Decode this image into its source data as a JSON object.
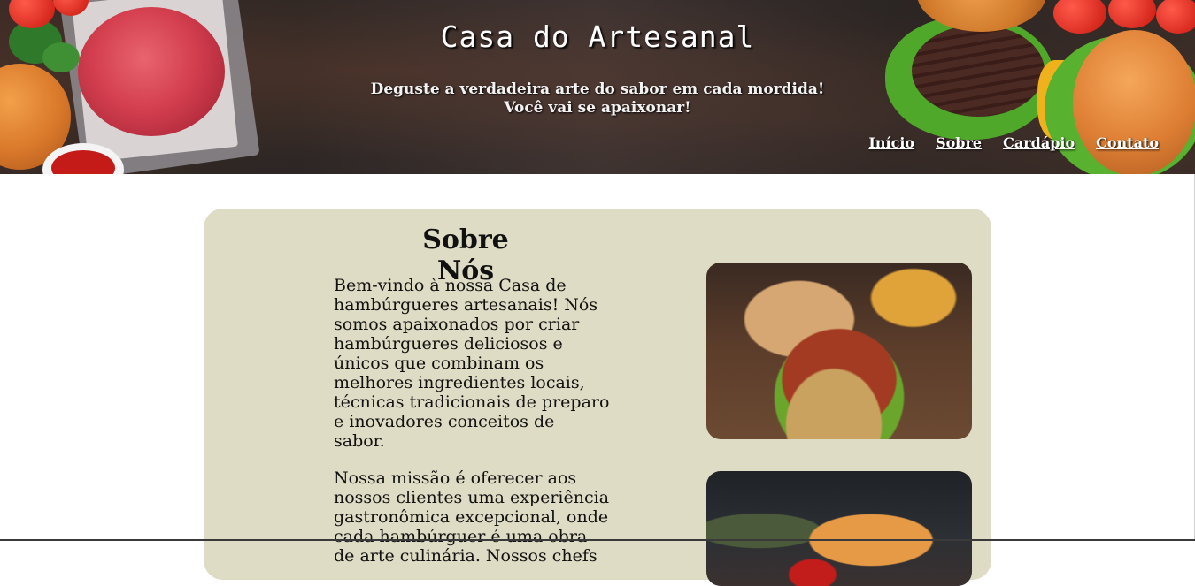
{
  "header": {
    "title": "Casa do Artesanal",
    "tagline_line1": "Deguste a verdadeira arte do sabor em cada mordida!",
    "tagline_line2": "Você vai se apaixonar!"
  },
  "nav": {
    "items": [
      {
        "label": "Início"
      },
      {
        "label": "Sobre"
      },
      {
        "label": "Cardápio"
      },
      {
        "label": "Contato"
      }
    ]
  },
  "about": {
    "title": "Sobre Nós",
    "paragraphs": [
      "Bem-vindo à nossa Casa de hambúrgueres artesanais! Nós somos apaixonados por criar hambúrgueres deliciosos e únicos que combinam os melhores ingredientes locais, técnicas tradicionais de preparo e inovadores conceitos de sabor.",
      "Nossa missão é oferecer aos nossos clientes uma experiência gastronômica excepcional, onde cada hambúrguer é uma obra de arte culinária. Nossos chefs"
    ]
  },
  "colors": {
    "card_background": "#dedcc4",
    "header_background": "#2f2826",
    "nav_text": "#ffffff"
  }
}
